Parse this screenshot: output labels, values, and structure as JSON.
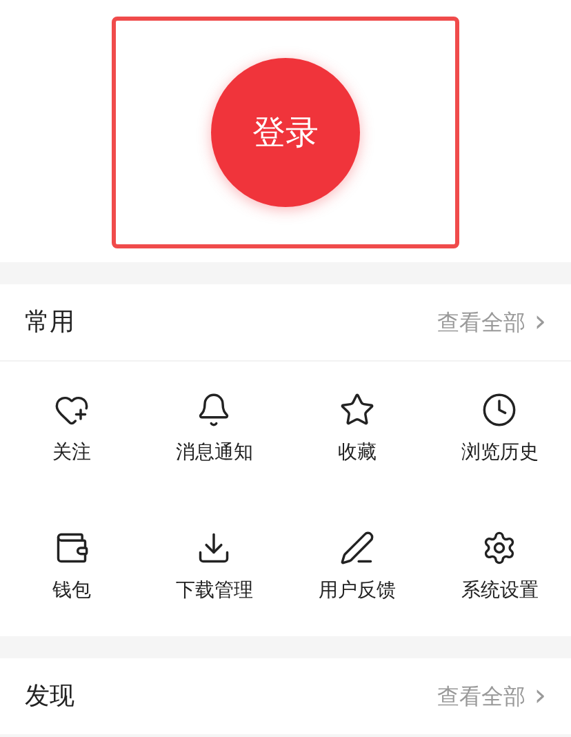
{
  "login": {
    "label": "登录"
  },
  "sections": [
    {
      "title": "常用",
      "more": "查看全部",
      "more_icon": "›",
      "items": [
        {
          "label": "关注",
          "kind": "follow"
        },
        {
          "label": "消息通知",
          "kind": "bell"
        },
        {
          "label": "收藏",
          "kind": "star"
        },
        {
          "label": "浏览历史",
          "kind": "clock"
        },
        {
          "label": "钱包",
          "kind": "wallet"
        },
        {
          "label": "下载管理",
          "kind": "download"
        },
        {
          "label": "用户反馈",
          "kind": "pen"
        },
        {
          "label": "系统设置",
          "kind": "gear"
        }
      ]
    },
    {
      "title": "发现",
      "more": "查看全部",
      "more_icon": "›"
    }
  ]
}
